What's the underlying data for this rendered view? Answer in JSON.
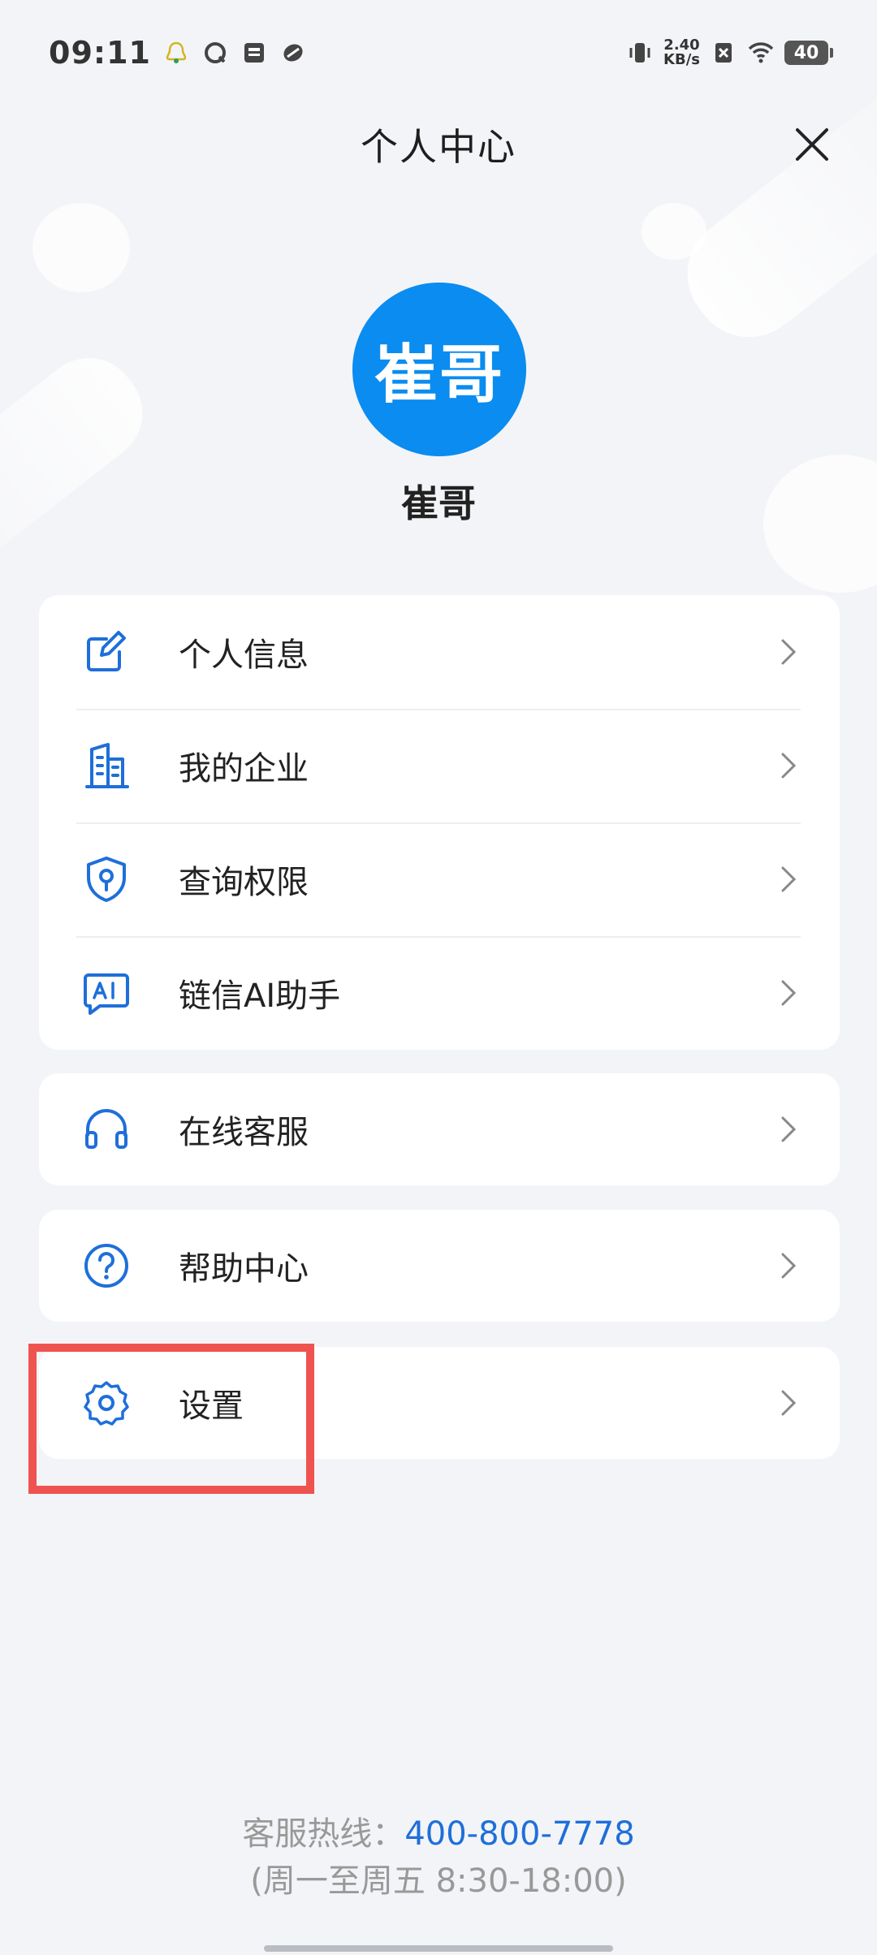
{
  "status_bar": {
    "time": "09:11",
    "net_speed_value": "2.40",
    "net_speed_unit": "KB/s",
    "battery": "40"
  },
  "header": {
    "title": "个人中心",
    "close_icon": "close-icon"
  },
  "profile": {
    "avatar_text": "崔哥",
    "avatar_color": "#0a8cf0",
    "name": "崔哥"
  },
  "menu_group_main": [
    {
      "label": "个人信息",
      "icon": "edit-icon"
    },
    {
      "label": "我的企业",
      "icon": "building-icon"
    },
    {
      "label": "查询权限",
      "icon": "shield-icon"
    },
    {
      "label": "链信AI助手",
      "icon": "ai-chat-icon"
    }
  ],
  "menu_service": {
    "label": "在线客服",
    "icon": "headset-icon"
  },
  "menu_help": {
    "label": "帮助中心",
    "icon": "question-icon"
  },
  "menu_settings": {
    "label": "设置",
    "icon": "gear-icon"
  },
  "footer": {
    "hotline_label": "客服热线：",
    "hotline_number": "400-800-7778",
    "hours": "(周一至周五 8:30-18:00)"
  },
  "colors": {
    "accent": "#1e6fd9",
    "background": "#f3f4f7",
    "highlight": "#ef5350"
  }
}
